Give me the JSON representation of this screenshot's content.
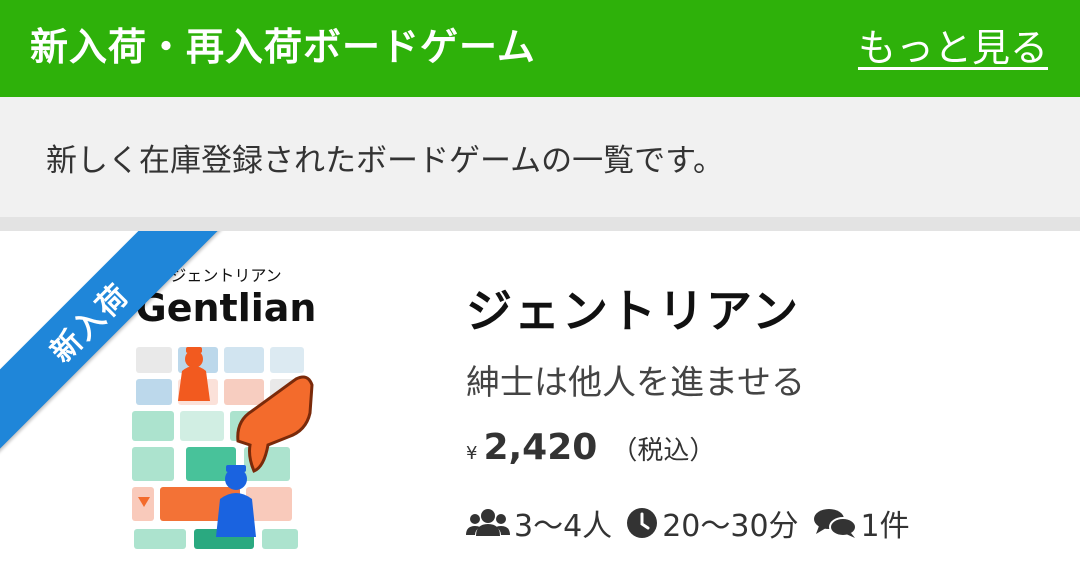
{
  "header": {
    "title": "新入荷・再入荷ボードゲーム",
    "more_link": "もっと見る"
  },
  "description": "新しく在庫登録されたボードゲームの一覧です。",
  "item": {
    "badge": "新入荷",
    "thumbnail": {
      "kana": "ジェントリアン",
      "logo": "Gentlian"
    },
    "title": "ジェントリアン",
    "subtitle": "紳士は他人を進ませる",
    "price_symbol": "¥",
    "price": "2,420",
    "tax_note": "（税込）",
    "players": "3〜4人",
    "play_time": "20〜30分",
    "reviews": "1件",
    "icons": {
      "players": "users-icon",
      "time": "clock-icon",
      "reviews": "comments-icon"
    }
  },
  "colors": {
    "header_bg": "#2eb10a",
    "badge_bg": "#1f86d9",
    "desc_bg": "#f1f1f1"
  }
}
